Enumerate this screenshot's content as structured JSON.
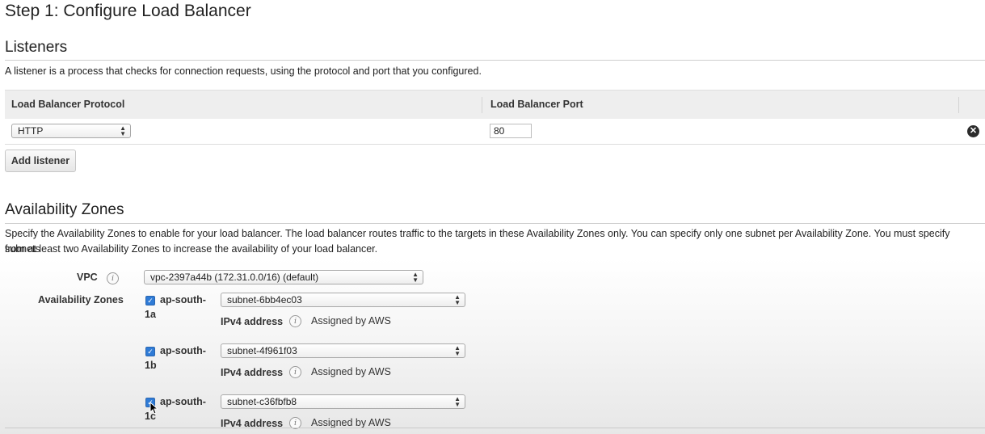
{
  "page": {
    "title": "Step 1: Configure Load Balancer"
  },
  "listeners": {
    "title": "Listeners",
    "description": "A listener is a process that checks for connection requests, using the protocol and port that you configured.",
    "columns": [
      "Load Balancer Protocol",
      "Load Balancer Port"
    ],
    "rows": [
      {
        "protocol": "HTTP",
        "port": "80"
      }
    ],
    "add_button": "Add listener",
    "remove_icon": "remove-circle-icon"
  },
  "availability_zones": {
    "title": "Availability Zones",
    "description_line1": "Specify the Availability Zones to enable for your load balancer. The load balancer routes traffic to the targets in these Availability Zones only. You can specify only one subnet per Availability Zone. You must specify subnets",
    "description_line2": "from at least two Availability Zones to increase the availability of your load balancer.",
    "vpc_label": "VPC",
    "vpc_value": "vpc-2397a44b (172.31.0.0/16) (default)",
    "zones_label": "Availability Zones",
    "info_icon_glyph": "i",
    "zones": [
      {
        "name_prefix": "ap-south-",
        "name_suffix": "1a",
        "checked": true,
        "subnet": "subnet-6bb4ec03",
        "ipv4_label": "IPv4 address",
        "ipv4_value": "Assigned by AWS"
      },
      {
        "name_prefix": "ap-south-",
        "name_suffix": "1b",
        "checked": true,
        "subnet": "subnet-4f961f03",
        "ipv4_label": "IPv4 address",
        "ipv4_value": "Assigned by AWS"
      },
      {
        "name_prefix": "ap-south-",
        "name_suffix": "1c",
        "checked": true,
        "subnet": "subnet-c36fbfb8",
        "ipv4_label": "IPv4 address",
        "ipv4_value": "Assigned by AWS"
      }
    ]
  },
  "colors": {
    "checkbox_blue": "#2f7bd6",
    "header_bg": "#eeeeee",
    "text": "#222222"
  }
}
